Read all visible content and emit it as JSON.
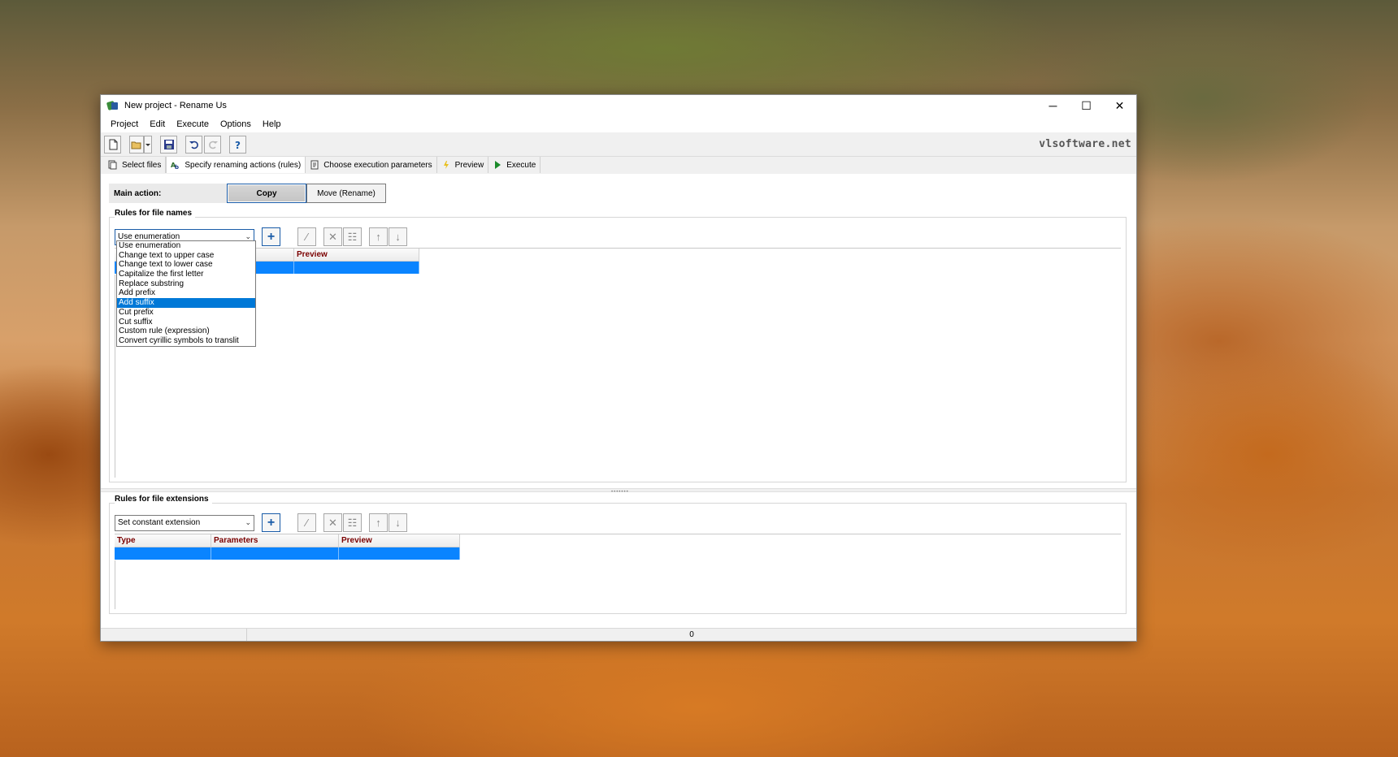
{
  "window": {
    "title": "New project - Rename Us",
    "controls": {
      "minimize": "─",
      "maximize": "☐",
      "close": "✕"
    }
  },
  "menu": [
    "Project",
    "Edit",
    "Execute",
    "Options",
    "Help"
  ],
  "toolbar": {
    "buttons": [
      "new-file-icon",
      "open-folder-icon",
      "dropdown-arrow-icon",
      "save-icon",
      "undo-icon",
      "redo-icon",
      "help-icon"
    ],
    "site": "vlsoftware.net"
  },
  "tabs": [
    {
      "label": "Select files",
      "icon": "files-icon"
    },
    {
      "label": "Specify renaming actions (rules)",
      "icon": "rules-icon",
      "active": true
    },
    {
      "label": "Choose execution parameters",
      "icon": "parameters-icon"
    },
    {
      "label": "Preview",
      "icon": "preview-icon"
    },
    {
      "label": "Execute",
      "icon": "play-icon"
    }
  ],
  "main_action": {
    "label": "Main action:",
    "options": [
      "Copy",
      "Move (Rename)"
    ],
    "selected": "Copy"
  },
  "file_names": {
    "title": "Rules for file names",
    "combo_value": "Use enumeration",
    "header_visible_fragment": "s",
    "header_preview": "Preview",
    "dropdown_items": [
      "Use enumeration",
      "Change text to upper case",
      "Change text to lower case",
      "Capitalize the first letter",
      "Replace substring",
      "Add prefix",
      "Add suffix",
      "Cut prefix",
      "Cut suffix",
      "Custom rule (expression)",
      "Convert cyrillic symbols to translit"
    ],
    "dropdown_selected": "Add suffix"
  },
  "file_extensions": {
    "title": "Rules for file extensions",
    "combo_value": "Set constant extension",
    "columns": [
      "Type",
      "Parameters",
      "Preview"
    ]
  },
  "status": {
    "count": "0"
  },
  "colors": {
    "selection": "#0a84ff",
    "header_text": "#7a0000",
    "accent": "#1a5ca8"
  }
}
